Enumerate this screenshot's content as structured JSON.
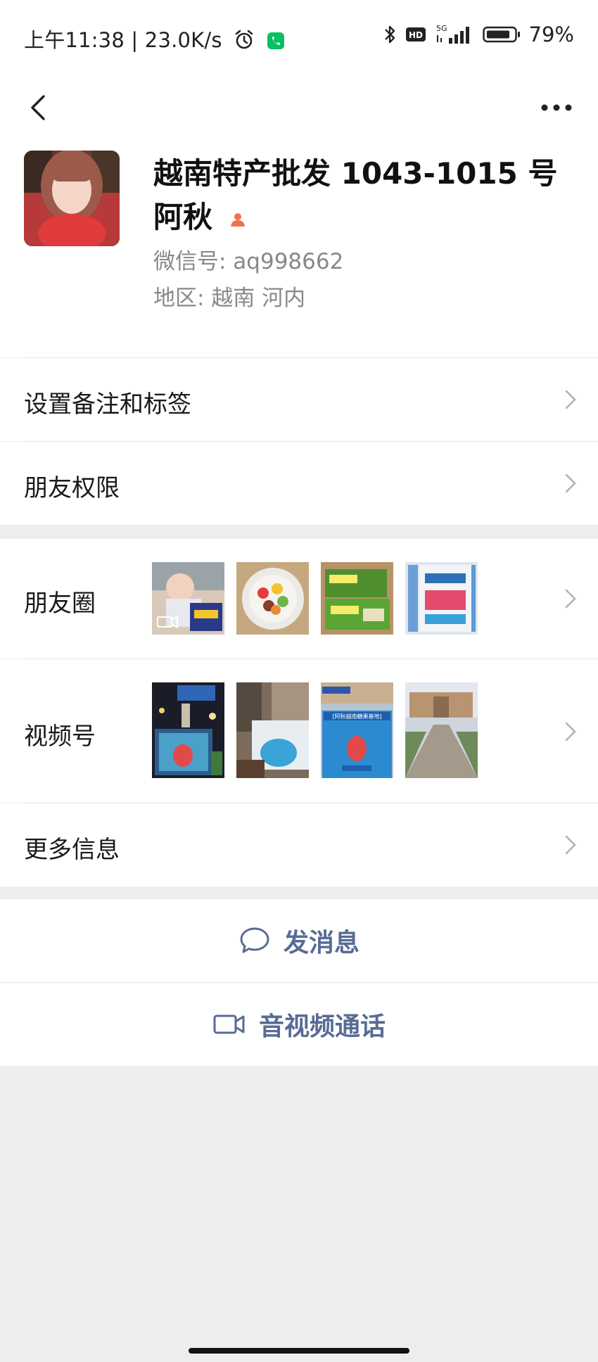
{
  "status": {
    "time": "上午11:38",
    "speed": "23.0K/s",
    "network": "5G",
    "battery": "79%"
  },
  "profile": {
    "name": "越南特产批发 1043-1015 号 阿秋",
    "wechat_id": "微信号:  aq998662",
    "region": "地区:  越南  河内"
  },
  "menu": {
    "remark": "设置备注和标签",
    "permission": "朋友权限",
    "moments": "朋友圈",
    "channels": "视频号",
    "more_info": "更多信息"
  },
  "channel_thumbs": {
    "t3_banner": "[阿秋越南糖果基地]"
  },
  "actions": {
    "message": "发消息",
    "call": "音视频通话"
  },
  "colors": {
    "link": "#576b95",
    "background": "#ededed"
  }
}
